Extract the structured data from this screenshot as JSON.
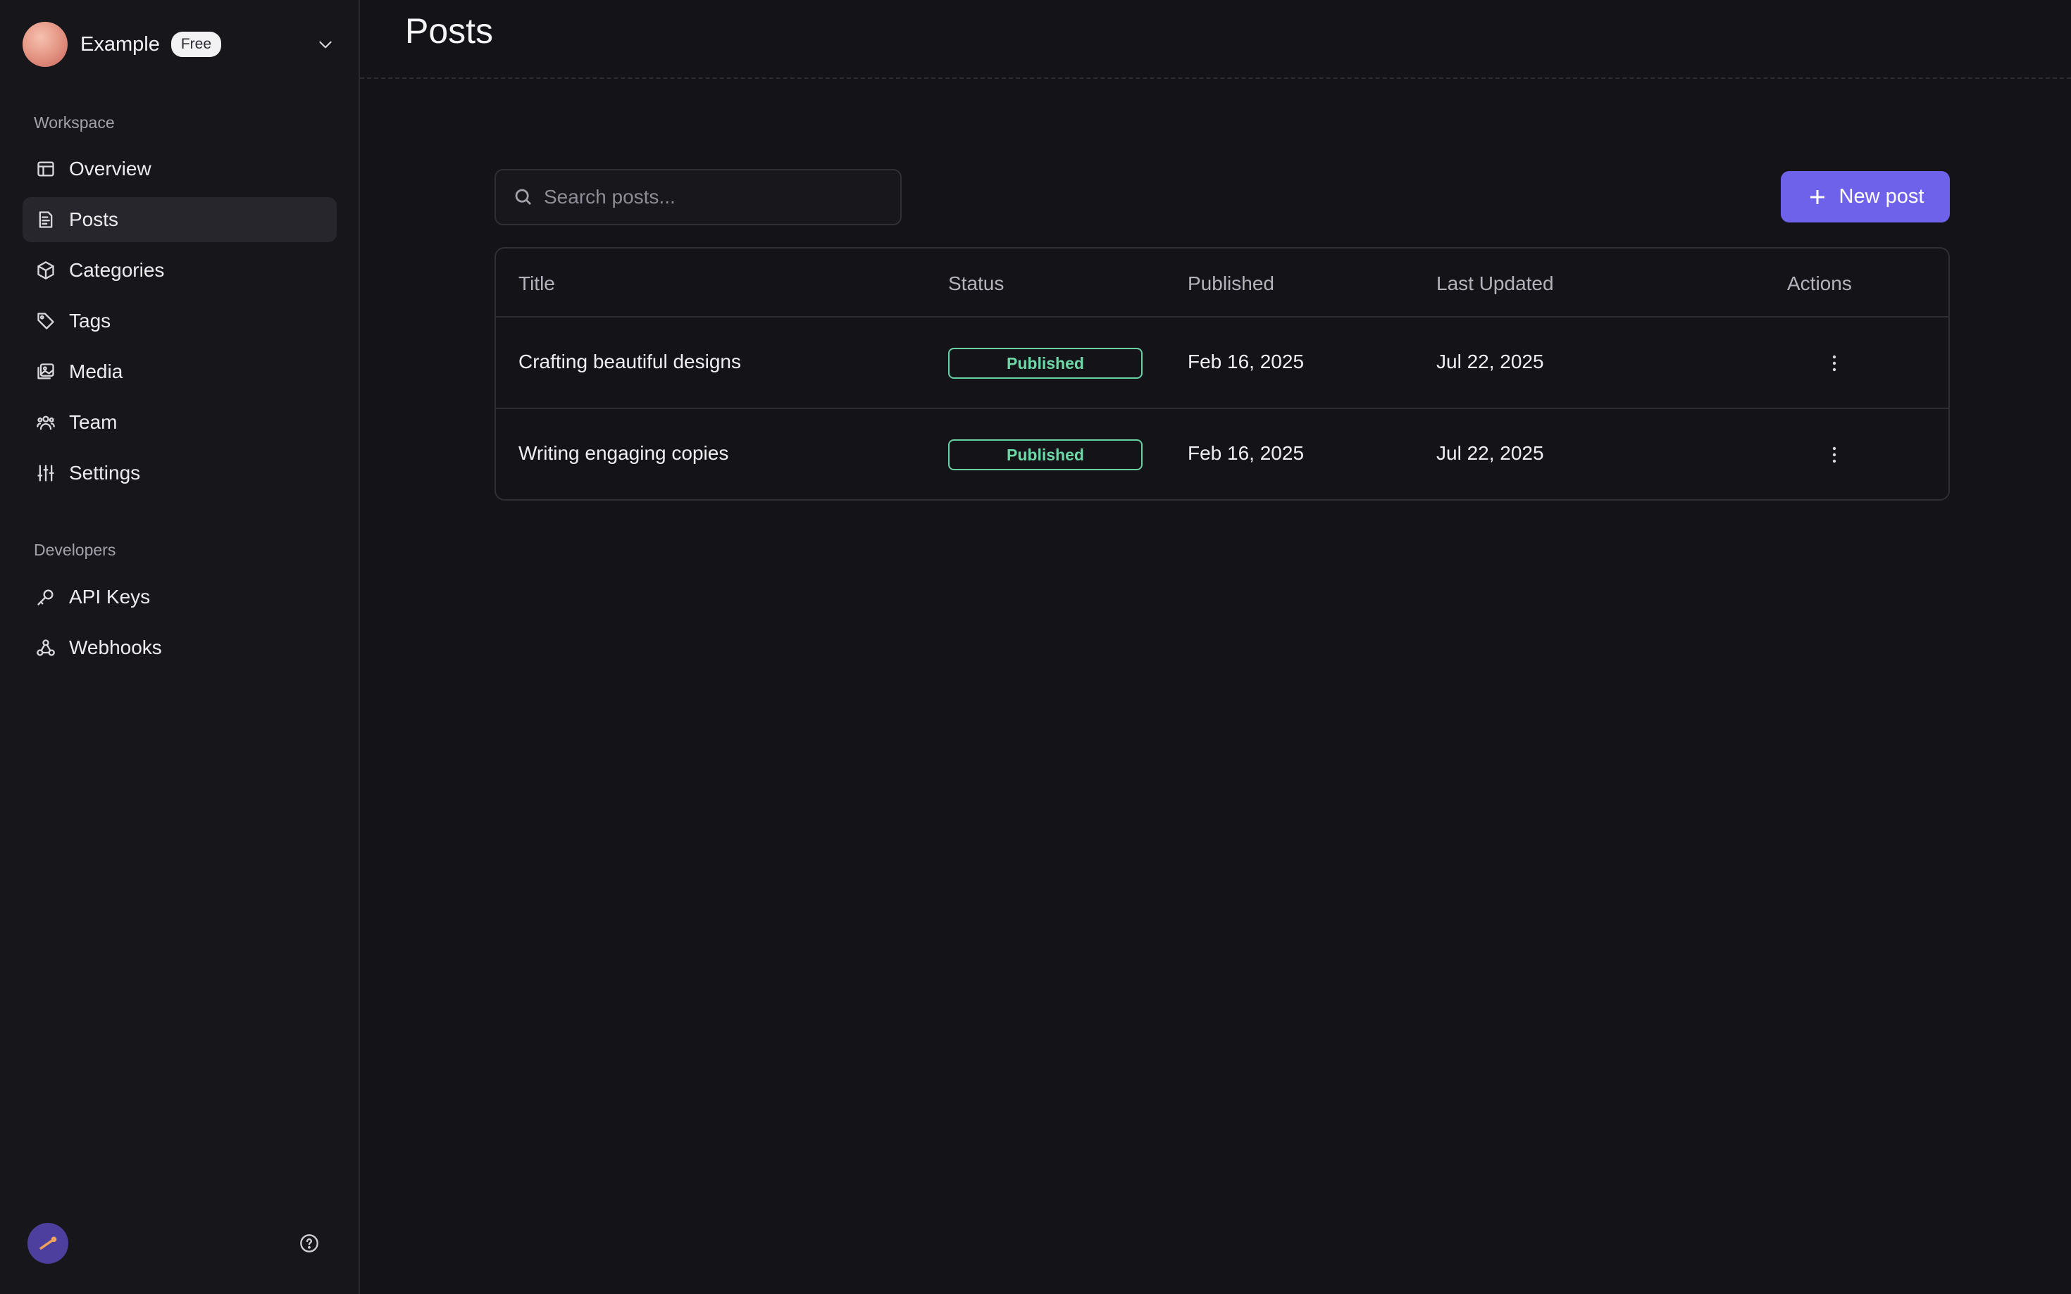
{
  "org": {
    "name": "Example",
    "plan": "Free"
  },
  "sidebar": {
    "workspace_label": "Workspace",
    "items": [
      {
        "label": "Overview",
        "icon": "layout-icon"
      },
      {
        "label": "Posts",
        "icon": "document-icon",
        "active": true
      },
      {
        "label": "Categories",
        "icon": "box-icon"
      },
      {
        "label": "Tags",
        "icon": "tag-icon"
      },
      {
        "label": "Media",
        "icon": "images-icon"
      },
      {
        "label": "Team",
        "icon": "users-icon"
      },
      {
        "label": "Settings",
        "icon": "sliders-icon"
      }
    ],
    "developers_label": "Developers",
    "dev_items": [
      {
        "label": "API Keys",
        "icon": "key-icon"
      },
      {
        "label": "Webhooks",
        "icon": "webhook-icon"
      }
    ]
  },
  "page": {
    "title": "Posts"
  },
  "search": {
    "placeholder": "Search posts..."
  },
  "actions": {
    "new_post_label": "New post"
  },
  "table": {
    "headers": [
      "Title",
      "Status",
      "Published",
      "Last Updated",
      "Actions"
    ],
    "rows": [
      {
        "title": "Crafting beautiful designs",
        "status": "Published",
        "published": "Feb 16, 2025",
        "updated": "Jul 22, 2025"
      },
      {
        "title": "Writing engaging copies",
        "status": "Published",
        "published": "Feb 16, 2025",
        "updated": "Jul 22, 2025"
      }
    ]
  },
  "colors": {
    "accent": "#6f62ea",
    "status_published": "#6fd8a8",
    "background": "#141318"
  }
}
